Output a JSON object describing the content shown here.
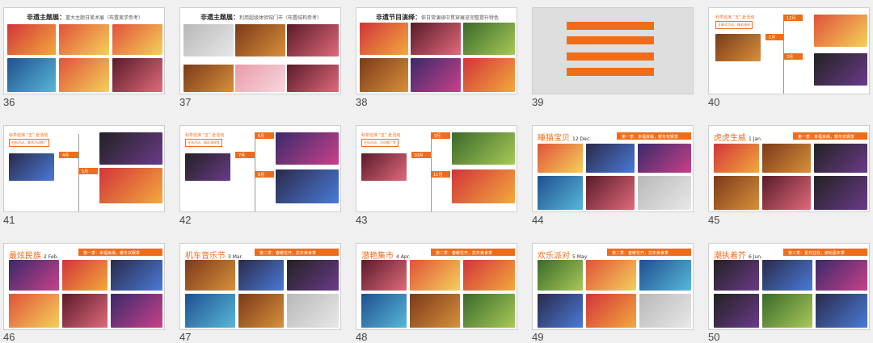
{
  "thumbnails": [
    {
      "number": "36",
      "title": "非遗主题展：",
      "subtitle": "重大主题日美术展（布置美学参考）"
    },
    {
      "number": "37",
      "title": "非遗主题展：",
      "subtitle": "利用超级体验馆门市（布置结构参考）"
    },
    {
      "number": "38",
      "title": "非遗节目演绎：",
      "subtitle": "依日常演绎中贯穿展览完整提升特色"
    },
    {
      "number": "39"
    },
    {
      "number": "40",
      "tag": "科学巡演 “五” 赴活动",
      "box": "开幕式活动、精彩演绎",
      "months": [
        "12月",
        "1月",
        "2月"
      ]
    },
    {
      "number": "41",
      "tag": "科学巡演 “五” 赴活动",
      "box": "创新活动、美术活动推广",
      "months": [
        "4月",
        "5月"
      ]
    },
    {
      "number": "42",
      "tag": "科学巡演 “五” 赴活动",
      "box": "开场活动、精彩演绎等",
      "months": [
        "6月",
        "7月",
        "8月"
      ]
    },
    {
      "number": "43",
      "tag": "科学巡演 “五” 赴活动",
      "box": "开场活动、活动推广等",
      "months": [
        "9月",
        "10月",
        "11月"
      ]
    },
    {
      "number": "44",
      "title": "睡猫宝贝",
      "date": "12 Dec.",
      "band": "第一季：幸福良缘，暖冬欢娱季"
    },
    {
      "number": "45",
      "title": "虎虎生威",
      "date": "1 Jan.",
      "band": "第一季：幸福良缘，暖冬欢娱季"
    },
    {
      "number": "46",
      "title": "最炫民族",
      "date": "2 Feb.",
      "band": "第一季：幸福良缘，暖冬欢娱季"
    },
    {
      "number": "47",
      "title": "机车音乐节",
      "date": "3 Mar.",
      "band": "第二季：春暖花开，抗年美食季"
    },
    {
      "number": "48",
      "title": "潜艳集市",
      "date": "4 Apr.",
      "band": "第二季：春暖花开，抗年美食季"
    },
    {
      "number": "49",
      "title": "欢乐派对",
      "date": "5 May.",
      "band": "第二季：春暖花开，抗年美食季"
    },
    {
      "number": "50",
      "title": "潮执着芥",
      "date": "6 Jun.",
      "band": "第三季：夏日狂欢，缤纷嘉年季"
    }
  ],
  "colors": {
    "accent": "#ef6d1a",
    "background": "#f0f0f0"
  }
}
